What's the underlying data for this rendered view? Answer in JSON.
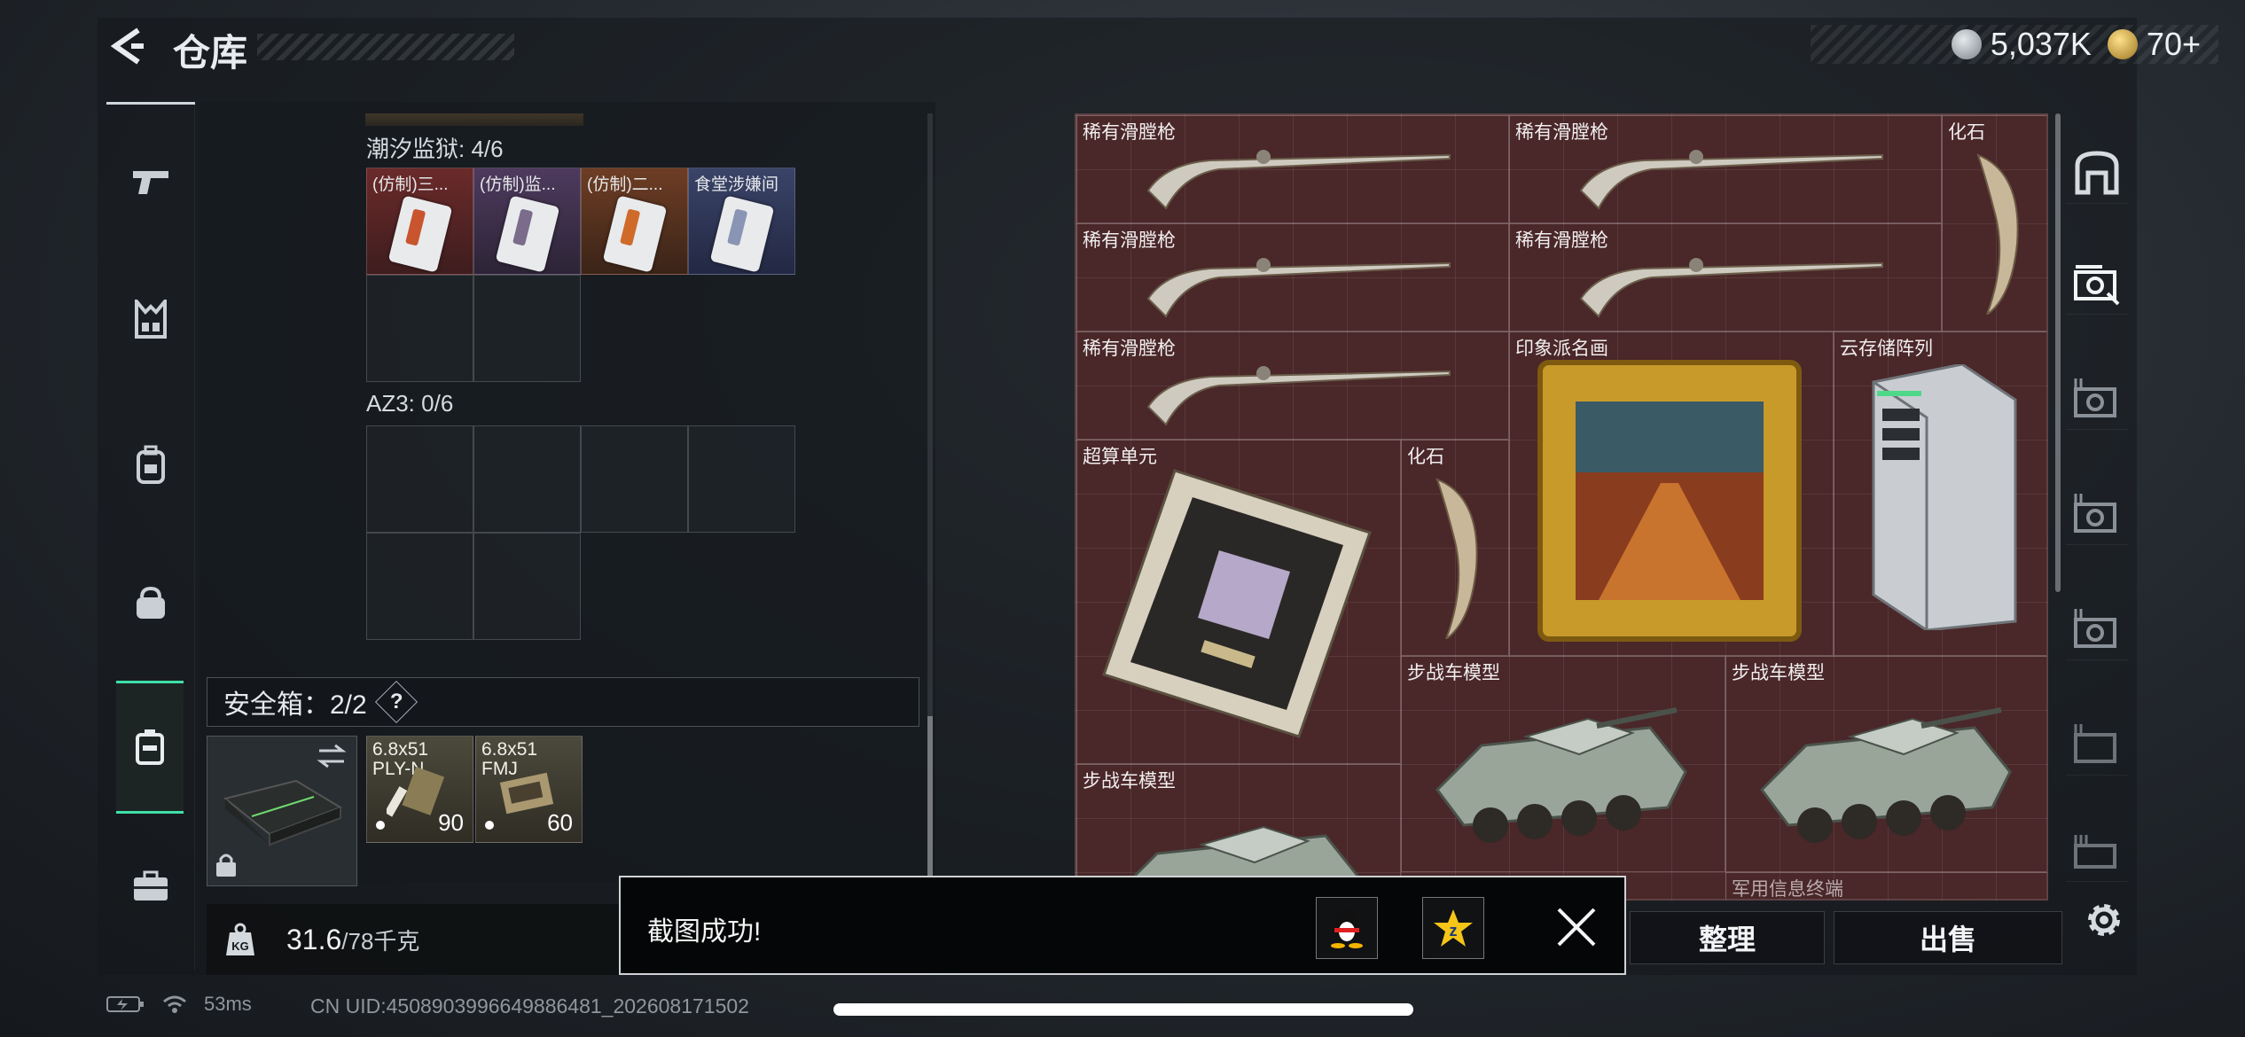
{
  "header": {
    "title": "仓库",
    "silver": "5,037K",
    "gold": "70+"
  },
  "left": {
    "sec1_label": "潮汐监狱: 4/6",
    "sec1_items": [
      "(仿制)三...",
      "(仿制)监...",
      "(仿制)二...",
      "食堂涉嫌间"
    ],
    "sec2_label": "AZ3: 0/6",
    "safe_label": "安全箱：2/2",
    "safe_help": "?",
    "ammo": [
      {
        "label": "6.8x51\nPLY-N",
        "qty": "90"
      },
      {
        "label": "6.8x51\nFMJ",
        "qty": "60"
      }
    ],
    "weight_value": "31.6",
    "weight_max": "/78千克",
    "kg_icon": "KG"
  },
  "stash": {
    "musket1": "稀有滑膛枪",
    "musket2": "稀有滑膛枪",
    "fossil1": "化石",
    "musket3": "稀有滑膛枪",
    "musket4": "稀有滑膛枪",
    "musket5": "稀有滑膛枪",
    "painting": "印象派名画",
    "storage": "云存储阵列",
    "supercomp": "超算单元",
    "fossil2": "化石",
    "ifv1": "步战车模型",
    "ifv2": "步战车模型",
    "ifv3": "步战车模型",
    "terminal": "军用信息终端"
  },
  "buttons": {
    "sort": "整理",
    "sell": "出售"
  },
  "toast": {
    "message": "截图成功!"
  },
  "status": {
    "ping": "53ms",
    "uid": "CN UID:4508903996649886481_202608171502"
  },
  "colors": {
    "accent": "#3fe0a8",
    "stash_bg": "#4a2729"
  }
}
